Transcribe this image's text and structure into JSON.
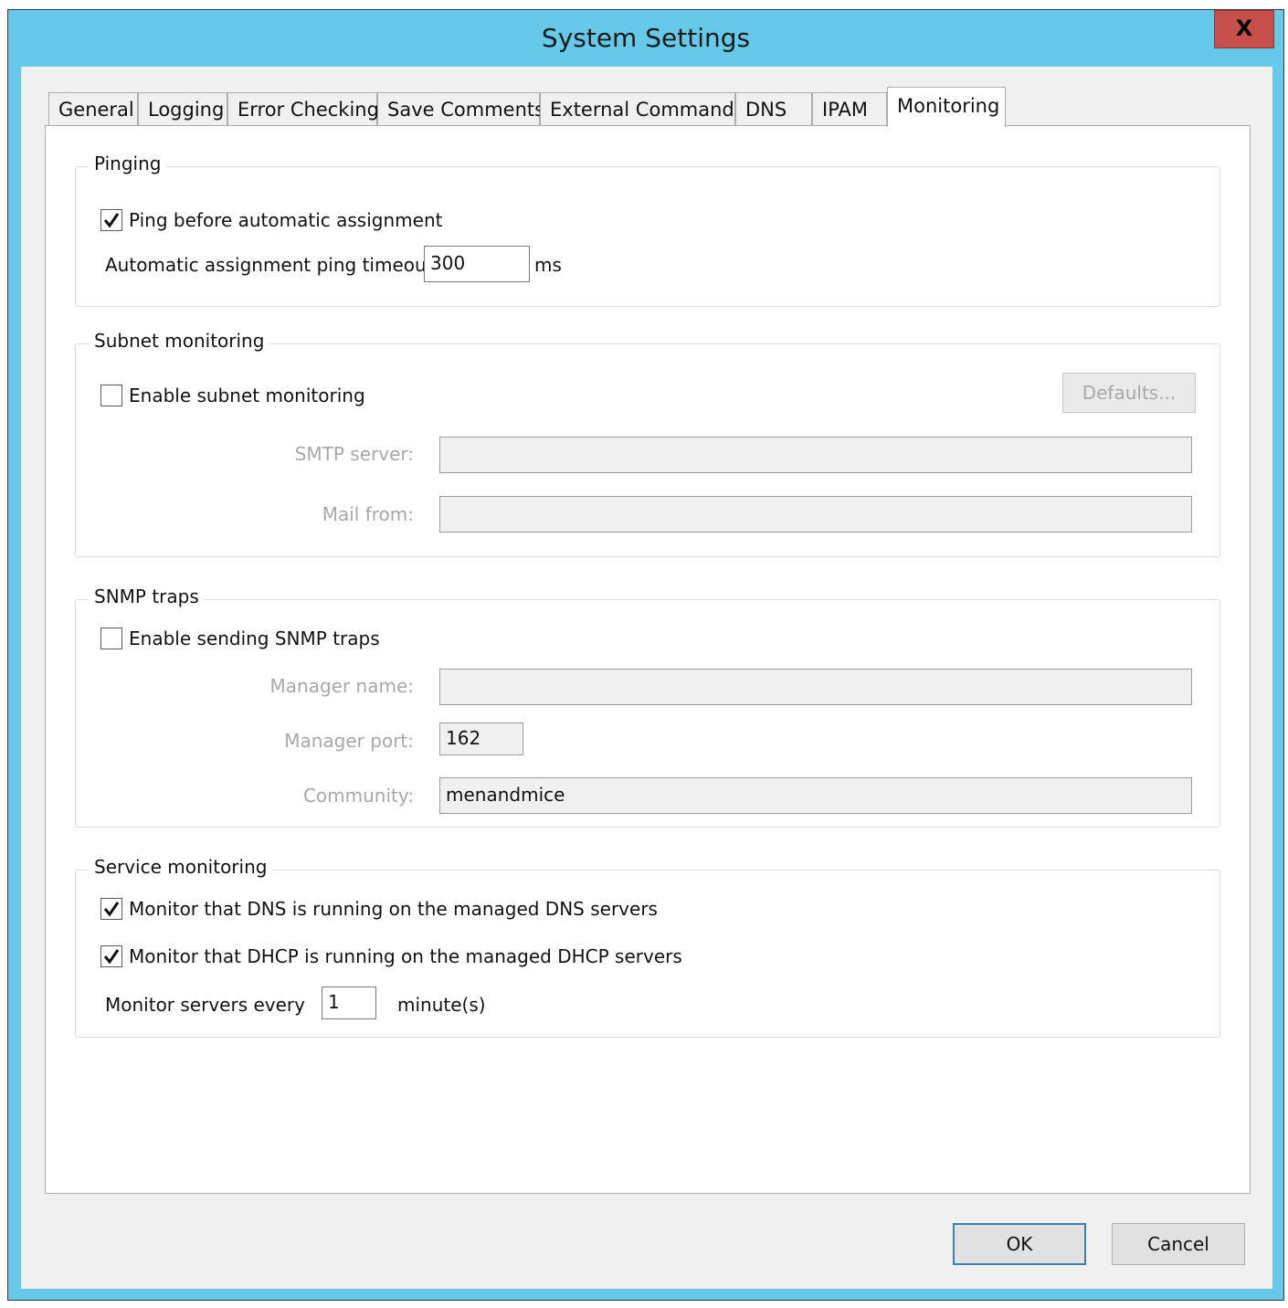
{
  "window": {
    "title": "System Settings",
    "close_label": "X"
  },
  "tabs": [
    {
      "label": "General"
    },
    {
      "label": "Logging"
    },
    {
      "label": "Error Checking"
    },
    {
      "label": "Save Comments"
    },
    {
      "label": "External Commands"
    },
    {
      "label": "DNS"
    },
    {
      "label": "IPAM"
    },
    {
      "label": "Monitoring",
      "active": true
    }
  ],
  "pinging": {
    "legend": "Pinging",
    "ping_checkbox_label": "Ping before automatic assignment",
    "ping_checked": true,
    "timeout_label": "Automatic assignment ping timeout:",
    "timeout_value": "300",
    "timeout_unit": "ms"
  },
  "subnet_monitoring": {
    "legend": "Subnet monitoring",
    "enable_label": "Enable subnet monitoring",
    "enable_checked": false,
    "defaults_button": "Defaults...",
    "smtp_label": "SMTP server:",
    "smtp_value": "",
    "mail_from_label": "Mail from:",
    "mail_from_value": ""
  },
  "snmp_traps": {
    "legend": "SNMP traps",
    "enable_label": "Enable sending SNMP traps",
    "enable_checked": false,
    "manager_name_label": "Manager name:",
    "manager_name_value": "",
    "manager_port_label": "Manager port:",
    "manager_port_value": "162",
    "community_label": "Community:",
    "community_value": "menandmice"
  },
  "service_monitoring": {
    "legend": "Service monitoring",
    "dns_label": "Monitor that DNS is running on the managed DNS servers",
    "dns_checked": true,
    "dhcp_label": "Monitor that DHCP is running on the managed DHCP servers",
    "dhcp_checked": true,
    "interval_label": "Monitor servers every",
    "interval_value": "1",
    "interval_unit": "minute(s)"
  },
  "footer": {
    "ok_label": "OK",
    "cancel_label": "Cancel"
  },
  "colors": {
    "titlebar": "#66c9e9",
    "close_button": "#c7504c",
    "default_button_border": "#3c7fb1"
  }
}
